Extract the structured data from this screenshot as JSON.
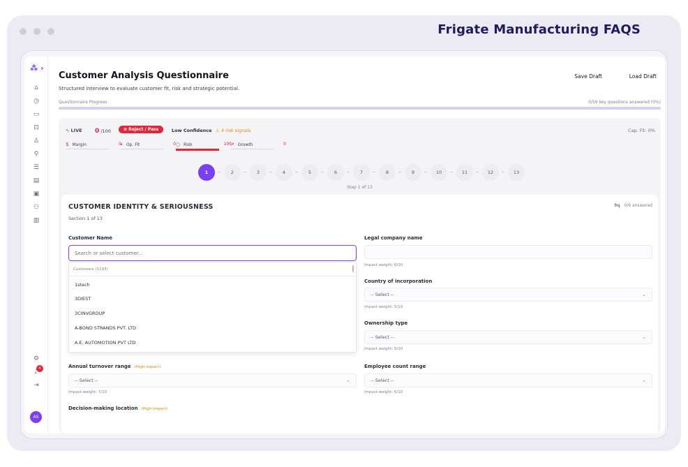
{
  "window": {
    "brand": "Frigate Manufacturing FAQS"
  },
  "rail": {
    "avatar_text": "AS",
    "notification_count": "4",
    "icons": [
      "home-icon",
      "clock-icon",
      "folder-icon",
      "truck-icon",
      "assign-icon",
      "wrench-icon",
      "database-icon",
      "document-icon",
      "building-icon",
      "users-icon",
      "chart-icon"
    ]
  },
  "header": {
    "title": "Customer Analysis Questionnaire",
    "subtitle": "Structured interview to evaluate customer fit, risk and strategic potential.",
    "save_draft": "Save Draft",
    "load_draft": "Load Draft",
    "progress_label": "Questionnaire Progress",
    "progress_count": "0/59 key questions answered (0%)",
    "progress_fraction": 0.0
  },
  "signals": {
    "live": "LIVE",
    "score": "0",
    "score_suffix": "/100",
    "reject": "Reject / Pass",
    "confidence": "Low Confidence",
    "risk_signals": "4 risk signals",
    "cap_fit": "Cap. Fit: 0%",
    "metrics": [
      {
        "label": "Margin",
        "value": "0",
        "icon": "$"
      },
      {
        "label": "Op. Fit",
        "value": "0",
        "icon": "⌖"
      },
      {
        "label": "Risk",
        "value": "100",
        "icon": "○"
      },
      {
        "label": "Growth",
        "value": "0",
        "icon": "↗"
      }
    ]
  },
  "steps": {
    "items": [
      "1",
      "2",
      "3",
      "4",
      "5",
      "6",
      "7",
      "8",
      "9",
      "10",
      "11",
      "12",
      "13"
    ],
    "active": 0,
    "label": "Step 1 of 13"
  },
  "section": {
    "title": "CUSTOMER IDENTITY & SERIOUSNESS",
    "subtitle": "Section 1 of 13",
    "answered": "0/9 answered",
    "answered_icon_text": "9q"
  },
  "fields": {
    "customer_name_label": "Customer Name",
    "customer_name_placeholder": "Search or select customer...",
    "dropdown_header": "Customers (1193)",
    "dropdown_items": [
      "1stech",
      "3DIEST",
      "3CINVGROUP",
      "A-BOND STRANDS PVT. LTD",
      "A.E. AUTOMOTION PVT LTD"
    ],
    "legal_label": "Legal company name",
    "legal_hint": "Impact weight: 6/10",
    "country_label": "Country of incorporation",
    "country_value": "-- Select --",
    "country_hint": "Impact weight: 5/10",
    "ownership_label": "Ownership type",
    "ownership_value": "-- Select --",
    "ownership_hint": "Impact weight: 5/10",
    "turnover_label": "Annual turnover range",
    "turnover_tag": "(High impact)",
    "turnover_value": "-- Select --",
    "turnover_hint": "Impact weight: 7/10",
    "employee_label": "Employee count range",
    "employee_value": "-- Select --",
    "employee_hint": "Impact weight: 6/10",
    "decision_label": "Decision-making location",
    "decision_tag": "(High impact)"
  },
  "colors": {
    "accent": "#7b3ff2",
    "danger": "#e3263b",
    "warning": "#d98a12"
  }
}
